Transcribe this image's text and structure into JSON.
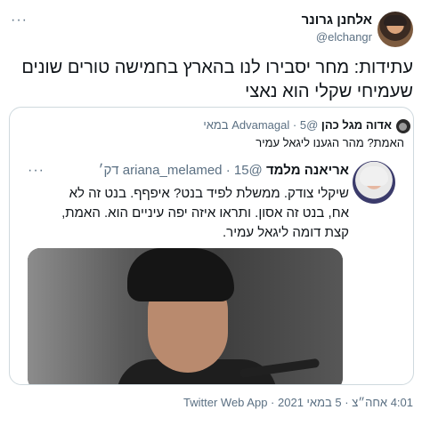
{
  "header": {
    "author_name": "אלחנן גרונר",
    "author_handle": "@elchangr",
    "more_label": "···"
  },
  "tweet": {
    "text": "עתידות: מחר יסבירו לנו בהארץ בחמישה טורים שונים שעמיחי שקלי הוא נאצי"
  },
  "quote": {
    "author_name": "אדוה מגל כהן",
    "author_handle": "@Advamagal",
    "separator": "·",
    "time": "5 במאי",
    "text": "האמת? מהר הגענו ליגאל עמיר"
  },
  "inner": {
    "author_name": "אריאנה מלמד",
    "author_handle": "@ariana_melamed",
    "separator": "·",
    "time": "15 דק׳",
    "more_label": "···",
    "text": "שיקלי צודק. ממשלת לפיד בנט? איפףף. בנט זה לא אח, בנט זה אסון. ותראו איזה יפה עיניים הוא. האמת, קצת דומה ליגאל עמיר."
  },
  "footer": {
    "meta": "4:01 אחה״צ · 5 במאי 2021 · Twitter Web App"
  }
}
